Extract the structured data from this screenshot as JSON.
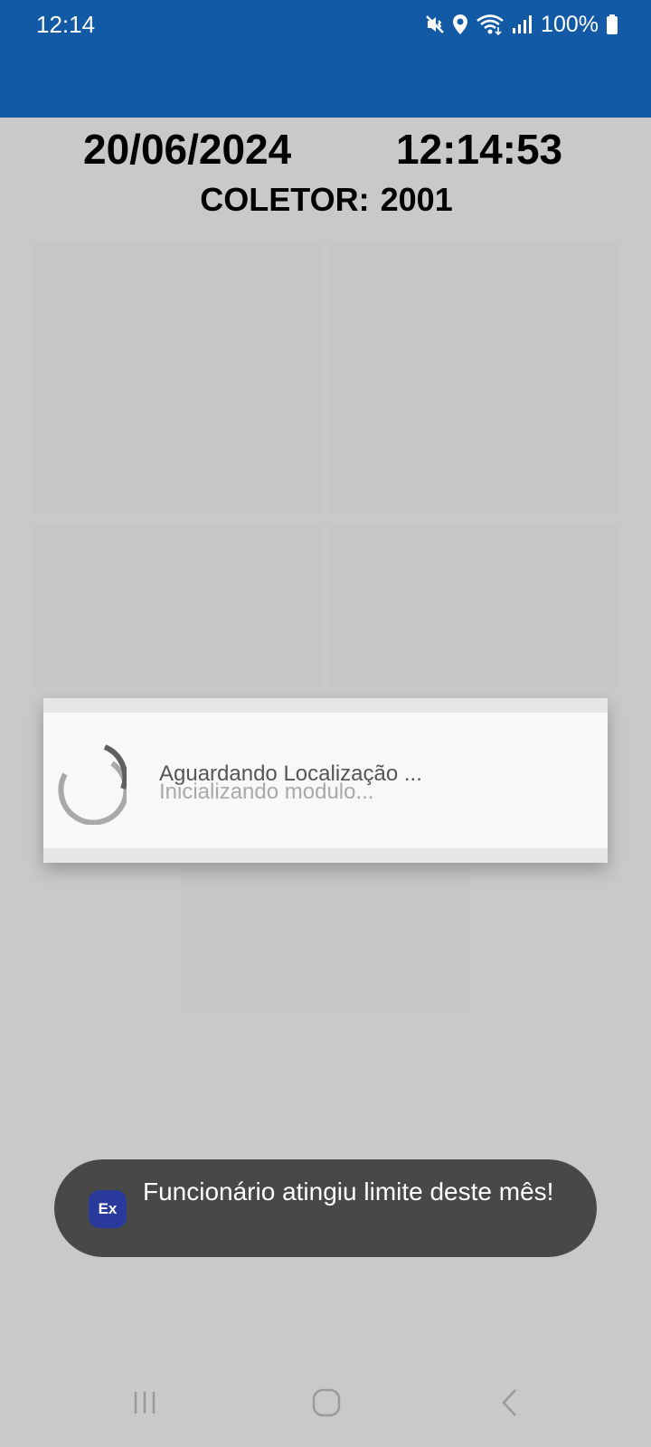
{
  "status_bar": {
    "time": "12:14",
    "battery": "100%",
    "icons": [
      "mute-vibrate-icon",
      "location-icon",
      "wifi-icon",
      "signal-icon",
      "battery-icon"
    ]
  },
  "header": {
    "date": "20/06/2024",
    "clock": "12:14:53",
    "collector_label": "COLETOR:",
    "collector_id": "2001"
  },
  "dialog": {
    "message_primary": "Aguardando Localização ...",
    "message_secondary": "Inicializando modulo..."
  },
  "toast": {
    "icon_text": "Ex",
    "message": "Funcionário atingiu limite deste mês!"
  },
  "navigation": {
    "icons": [
      "recents-icon",
      "home-icon",
      "back-icon"
    ]
  },
  "colors": {
    "app_bar": "#125aa5",
    "background_dimmed": "#c9c9c9",
    "toast_background": "#484848",
    "toast_icon": "#2a3a9c"
  }
}
